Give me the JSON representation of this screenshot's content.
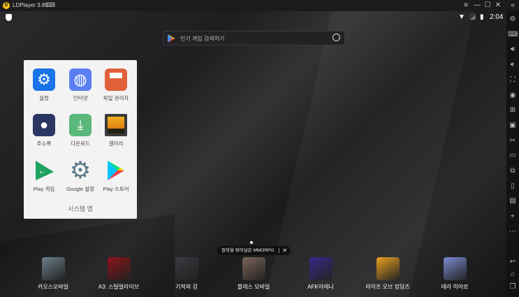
{
  "window": {
    "title": "LDPlayer 3.85",
    "controls": [
      "menu",
      "minimize",
      "maximize",
      "close",
      "collapse"
    ]
  },
  "statusbar": {
    "time": "2:04"
  },
  "search": {
    "placeholder": "인기 게임 검색하기"
  },
  "folder": {
    "name": "시스템 앱",
    "apps": [
      {
        "label": "설정",
        "icon": "settings-icon",
        "color": "#1a73e8"
      },
      {
        "label": "인터넷",
        "icon": "browser-icon",
        "color": "#5b7ff0"
      },
      {
        "label": "파일 관리자",
        "icon": "file-manager-icon",
        "color": "#e0603a"
      },
      {
        "label": "주소록",
        "icon": "contacts-icon",
        "color": "#2b3763"
      },
      {
        "label": "다운로드",
        "icon": "download-icon",
        "color": "#5ab87a"
      },
      {
        "label": "갤러리",
        "icon": "gallery-icon",
        "color": "#3a3a3a"
      },
      {
        "label": "Play 게임",
        "icon": "play-games-icon",
        "color": "#1ea362"
      },
      {
        "label": "Google 설정",
        "icon": "google-settings-icon",
        "color": "#5f7a89"
      },
      {
        "label": "Play 스토어",
        "icon": "play-store-icon",
        "color": "#00c4ff"
      }
    ]
  },
  "tooltip": {
    "text": "원작을 뛰어넘은 MMORPG",
    "close": "✕"
  },
  "dock": [
    {
      "label": "카오스모바일",
      "color": "#6b7e8a"
    },
    {
      "label": "A3: 스틸얼라이브",
      "color": "#8a1418"
    },
    {
      "label": "기적의 검",
      "color": "#3a3a40"
    },
    {
      "label": "블레스 모바일",
      "color": "#7a6458"
    },
    {
      "label": "AFK아레나",
      "color": "#3a2a8a"
    },
    {
      "label": "라이즈 오브 킹덤즈",
      "color": "#e8a020"
    },
    {
      "label": "테라 히어로",
      "color": "#7a8ad0"
    }
  ],
  "sidebar": [
    "settings",
    "keyboard",
    "volume-up",
    "volume-down",
    "fullscreen",
    "record",
    "add-window",
    "screenshot",
    "cut",
    "video",
    "resize",
    "rotate",
    "display",
    "location",
    "more",
    "back",
    "home",
    "recents"
  ]
}
